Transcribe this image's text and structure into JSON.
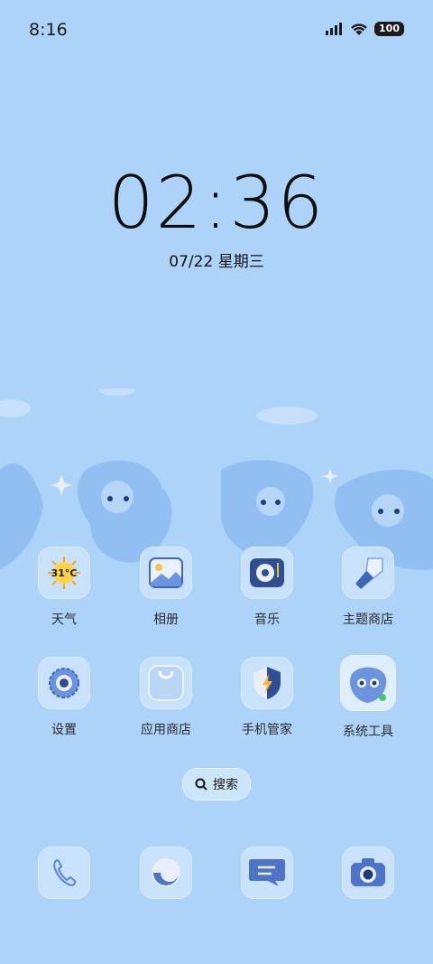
{
  "status_bar": {
    "time": "8:16",
    "battery": "100"
  },
  "lock_clock": {
    "time": "02:36",
    "date": "07/22 星期三"
  },
  "apps": [
    {
      "label": "天气",
      "icon": "weather-icon",
      "temp": "31°C"
    },
    {
      "label": "相册",
      "icon": "gallery-icon"
    },
    {
      "label": "音乐",
      "icon": "music-icon"
    },
    {
      "label": "主题商店",
      "icon": "theme-store-icon"
    },
    {
      "label": "设置",
      "icon": "settings-icon"
    },
    {
      "label": "应用商店",
      "icon": "app-store-icon"
    },
    {
      "label": "手机管家",
      "icon": "phone-manager-icon"
    },
    {
      "label": "系统工具",
      "icon": "system-tools-icon"
    }
  ],
  "search": {
    "label": "搜索"
  },
  "dock": [
    {
      "icon": "phone-icon"
    },
    {
      "icon": "browser-icon"
    },
    {
      "icon": "messages-icon"
    },
    {
      "icon": "camera-icon"
    }
  ],
  "colors": {
    "background": "#aed3f8",
    "icon_tile": "#cde4fb",
    "accent_dark": "#2f4f92"
  }
}
